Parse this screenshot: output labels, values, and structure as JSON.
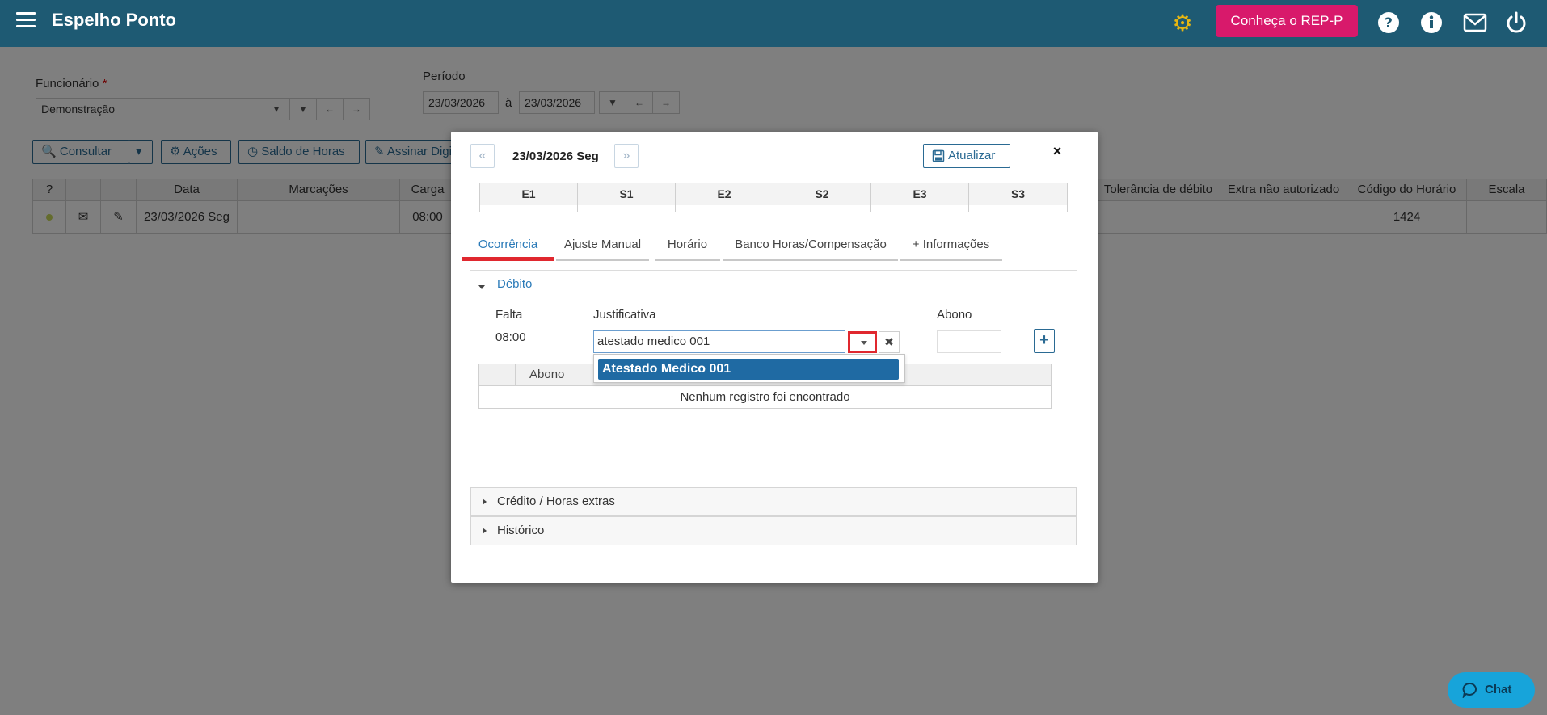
{
  "topbar": {
    "title": "Espelho Ponto",
    "rep_button": "Conheça o REP-P"
  },
  "filters": {
    "funcionario_label": "Funcionário",
    "required_mark": "*",
    "funcionario_value": "Demonstração",
    "periodo_label": "Período",
    "date_from": "23/03/2026",
    "date_sep": "à",
    "date_to": "23/03/2026"
  },
  "toolbar": {
    "consultar": "Consultar",
    "acoes": "Ações",
    "saldo": "Saldo de Horas",
    "assinar": "Assinar Digitalmente"
  },
  "grid": {
    "help": "?",
    "headers": [
      "Data",
      "Marcações",
      "Carga horária",
      "Tolerância de débito",
      "Extra não autorizado",
      "Código do Horário",
      "Escala"
    ],
    "row": {
      "data": "23/03/2026 Seg",
      "carga": "08:00",
      "codigo": "1424"
    }
  },
  "modal": {
    "prev": "«",
    "next": "»",
    "date": "23/03/2026 Seg",
    "update_button": "Atualizar",
    "close": "×",
    "es_headers": [
      "E1",
      "S1",
      "E2",
      "S2",
      "E3",
      "S3"
    ],
    "tabs": [
      "Ocorrência",
      "Ajuste Manual",
      "Horário",
      "Banco Horas/Compensação",
      "+ Informações"
    ],
    "section_debito": "Débito",
    "falta_label": "Falta",
    "falta_value": "08:00",
    "justificativa_label": "Justificativa",
    "justificativa_value": "atestado medico 001",
    "clear": "✖",
    "abono_label": "Abono",
    "add": "+",
    "inner_table_header": "Abono",
    "empty_message": "Nenhum registro foi encontrado",
    "dropdown_option": "Atestado Medico 001",
    "panel_credito": "Crédito / Horas extras",
    "panel_historico": "Histórico"
  },
  "chat": {
    "label": "Chat"
  },
  "colors": {
    "topbar": "#1e5a73",
    "rep": "#d8196b",
    "accent": "#2a7ab8",
    "highlight": "#e0282f",
    "chat": "#17a4da"
  }
}
